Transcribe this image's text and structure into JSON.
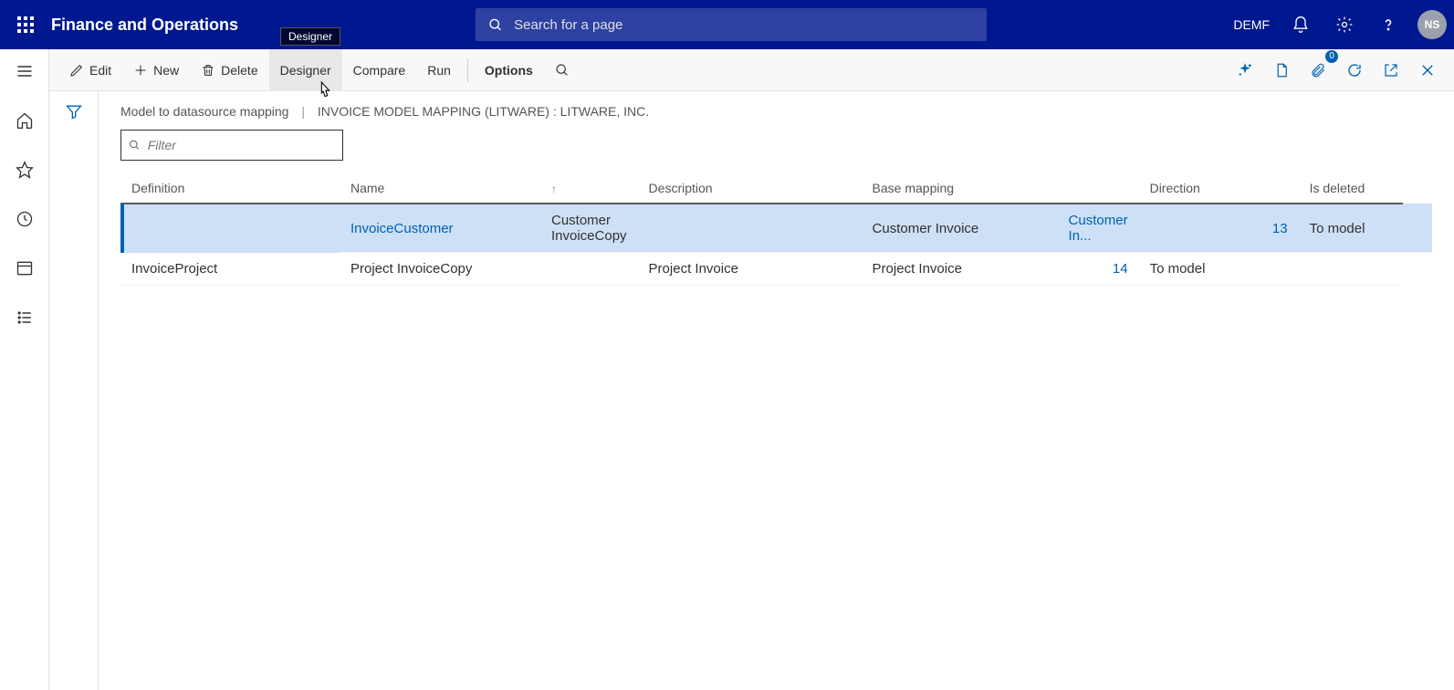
{
  "app": {
    "title": "Finance and Operations"
  },
  "search": {
    "placeholder": "Search for a page"
  },
  "topright": {
    "company": "DEMF",
    "avatar": "NS"
  },
  "tooltip": {
    "designer": "Designer"
  },
  "actions": {
    "edit": "Edit",
    "new": "New",
    "delete": "Delete",
    "designer": "Designer",
    "compare": "Compare",
    "run": "Run",
    "options": "Options",
    "badge": "0"
  },
  "breadcrumb": {
    "a": "Model to datasource mapping",
    "b": "INVOICE MODEL MAPPING (LITWARE) : LITWARE, INC."
  },
  "filter": {
    "placeholder": "Filter"
  },
  "columns": {
    "definition": "Definition",
    "name": "Name",
    "description": "Description",
    "basemapping": "Base mapping",
    "direction": "Direction",
    "isdeleted": "Is deleted"
  },
  "rows": [
    {
      "definition": "InvoiceCustomer",
      "name": "Customer InvoiceCopy",
      "description": "Customer Invoice",
      "basemapping": "Customer In...",
      "basemapping_link": true,
      "num": "13",
      "direction": "To model",
      "isdeleted": "",
      "selected": true
    },
    {
      "definition": "InvoiceProject",
      "name": "Project InvoiceCopy",
      "description": "Project Invoice",
      "basemapping": "Project Invoice",
      "basemapping_link": false,
      "num": "14",
      "direction": "To model",
      "isdeleted": "",
      "selected": false
    }
  ]
}
